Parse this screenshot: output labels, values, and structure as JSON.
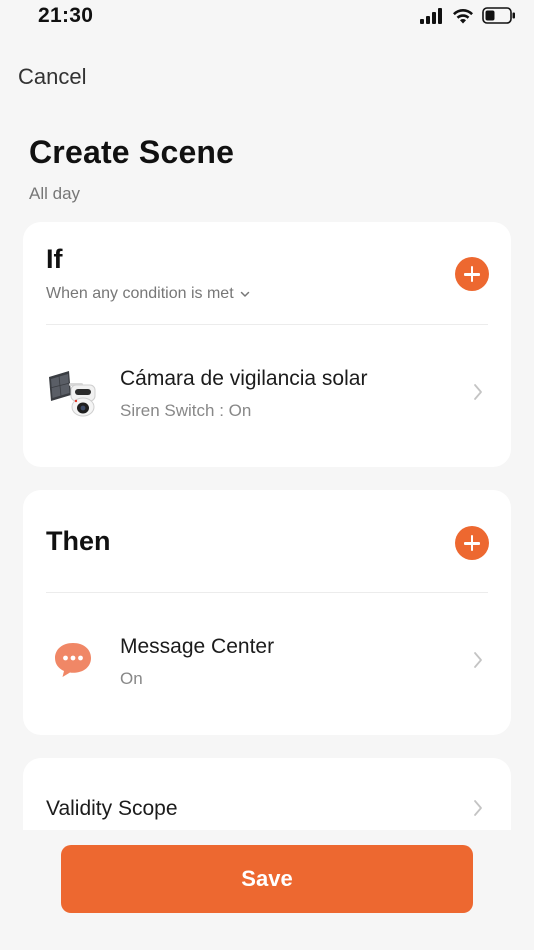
{
  "status_bar": {
    "time": "21:30"
  },
  "header": {
    "cancel_label": "Cancel"
  },
  "page": {
    "title": "Create Scene",
    "subtitle": "All day"
  },
  "if_section": {
    "title": "If",
    "condition_mode": "When any condition is met",
    "items": [
      {
        "title": "Cámara de vigilancia solar",
        "detail": "Siren Switch : On",
        "icon": "solar-camera-icon"
      }
    ]
  },
  "then_section": {
    "title": "Then",
    "items": [
      {
        "title": "Message Center",
        "detail": "On",
        "icon": "message-icon"
      }
    ]
  },
  "validity": {
    "label": "Validity Scope"
  },
  "footer": {
    "save_label": "Save"
  },
  "colors": {
    "accent": "#ed6830",
    "background": "#f6f6f6",
    "card": "#ffffff"
  }
}
